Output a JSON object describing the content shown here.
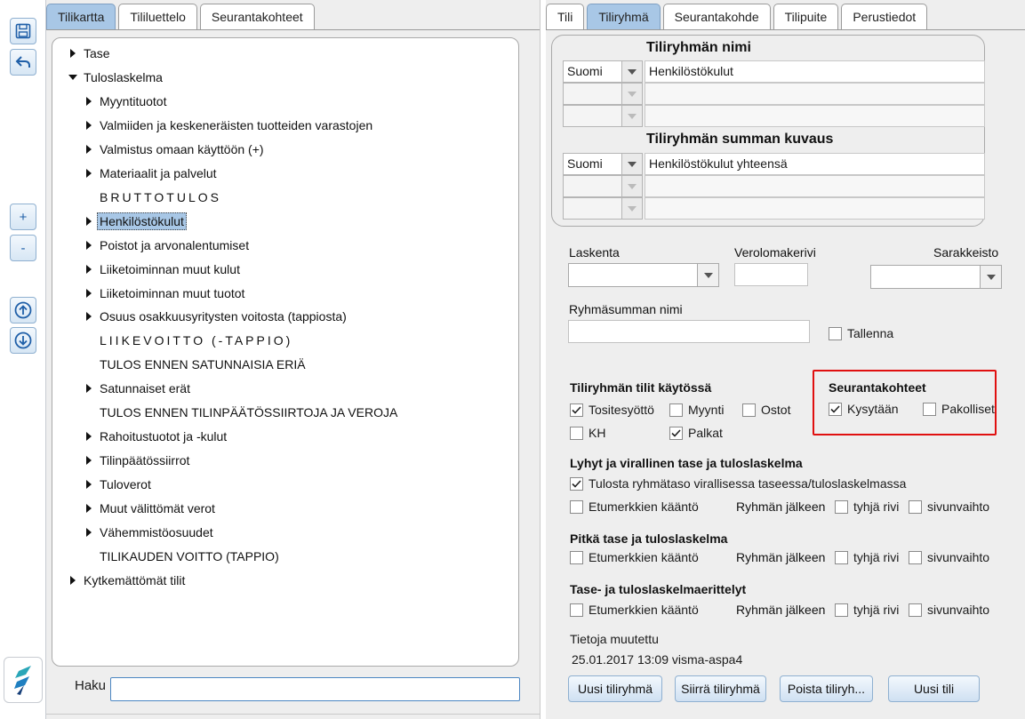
{
  "left_tabs": [
    {
      "label": "Tilikartta",
      "active": true
    },
    {
      "label": "Tililuettelo",
      "active": false
    },
    {
      "label": "Seurantakohteet",
      "active": false
    }
  ],
  "right_tabs": [
    {
      "label": "Tili",
      "active": false
    },
    {
      "label": "Tiliryhmä",
      "active": true
    },
    {
      "label": "Seurantakohde",
      "active": false
    },
    {
      "label": "Tilipuite",
      "active": false
    },
    {
      "label": "Perustiedot",
      "active": false
    }
  ],
  "toolbar": {
    "save_icon": "save-icon",
    "undo_icon": "undo-icon",
    "plus_label": "+",
    "minus_label": "-",
    "up_icon": "arrow-up-circle-icon",
    "down_icon": "arrow-down-circle-icon",
    "logo_icon": "app-logo-icon"
  },
  "tree": [
    {
      "label": "Tase",
      "level": 0,
      "arrow": "right"
    },
    {
      "label": "Tuloslaskelma",
      "level": 0,
      "arrow": "down"
    },
    {
      "label": "Myyntituotot",
      "level": 1,
      "arrow": "right"
    },
    {
      "label": "Valmiiden ja keskeneräisten tuotteiden varastojen",
      "level": 1,
      "arrow": "right"
    },
    {
      "label": "Valmistus omaan käyttöön (+)",
      "level": 1,
      "arrow": "right"
    },
    {
      "label": "Materiaalit ja palvelut",
      "level": 1,
      "arrow": "right"
    },
    {
      "label": "BRUTTOTULOS",
      "level": 1,
      "arrow": "none",
      "spaced": true
    },
    {
      "label": "Henkilöstökulut",
      "level": 1,
      "arrow": "right",
      "selected": true
    },
    {
      "label": "Poistot ja arvonalentumiset",
      "level": 1,
      "arrow": "right"
    },
    {
      "label": "Liiketoiminnan muut kulut",
      "level": 1,
      "arrow": "right"
    },
    {
      "label": "Liiketoiminnan muut tuotot",
      "level": 1,
      "arrow": "right"
    },
    {
      "label": "Osuus osakkuusyritysten voitosta (tappiosta)",
      "level": 1,
      "arrow": "right"
    },
    {
      "label": "LIIKEVOITTO (-TAPPIO)",
      "level": 1,
      "arrow": "none",
      "spaced": true
    },
    {
      "label": "TULOS ENNEN SATUNNAISIA ERIÄ",
      "level": 1,
      "arrow": "none"
    },
    {
      "label": "Satunnaiset erät",
      "level": 1,
      "arrow": "right"
    },
    {
      "label": "TULOS ENNEN TILINPÄÄTÖSSIIRTOJA  JA VEROJA",
      "level": 1,
      "arrow": "none"
    },
    {
      "label": "Rahoitustuotot ja -kulut",
      "level": 1,
      "arrow": "right"
    },
    {
      "label": "Tilinpäätössiirrot",
      "level": 1,
      "arrow": "right"
    },
    {
      "label": "Tuloverot",
      "level": 1,
      "arrow": "right"
    },
    {
      "label": "Muut välittömät verot",
      "level": 1,
      "arrow": "right"
    },
    {
      "label": "Vähemmistöosuudet",
      "level": 1,
      "arrow": "right"
    },
    {
      "label": "TILIKAUDEN VOITTO (TAPPIO)",
      "level": 1,
      "arrow": "none"
    },
    {
      "label": "Kytkemättömät tilit",
      "level": 0,
      "arrow": "right"
    }
  ],
  "search": {
    "label": "Haku",
    "value": ""
  },
  "group": {
    "name_title": "Tiliryhmän nimi",
    "name_rows": [
      {
        "lang": "Suomi",
        "value": "Henkilöstökulut"
      },
      {
        "lang": "",
        "value": ""
      },
      {
        "lang": "",
        "value": ""
      }
    ],
    "sum_title": "Tiliryhmän summan kuvaus",
    "sum_rows": [
      {
        "lang": "Suomi",
        "value": "Henkilöstökulut yhteensä"
      },
      {
        "lang": "",
        "value": ""
      },
      {
        "lang": "",
        "value": ""
      }
    ]
  },
  "fields": {
    "laskenta_label": "Laskenta",
    "laskenta_value": "",
    "verolomakerivi_label": "Verolomakerivi",
    "verolomakerivi_value": "",
    "sarakkeisto_label": "Sarakkeisto",
    "sarakkeisto_value": "",
    "ryhmasumma_label": "Ryhmäsumman nimi",
    "ryhmasumma_value": "",
    "tallenna_label": "Tallenna",
    "tallenna_checked": false
  },
  "accounts_in_use": {
    "title": "Tiliryhmän tilit käytössä",
    "items": [
      {
        "label": "Tositesyöttö",
        "checked": true
      },
      {
        "label": "Myynti",
        "checked": false
      },
      {
        "label": "Ostot",
        "checked": false
      },
      {
        "label": "KH",
        "checked": false
      },
      {
        "label": "Palkat",
        "checked": true
      }
    ]
  },
  "tracking": {
    "title": "Seurantakohteet",
    "items": [
      {
        "label": "Kysytään",
        "checked": true
      },
      {
        "label": "Pakolliset",
        "checked": false
      }
    ]
  },
  "short_report": {
    "title": "Lyhyt ja virallinen tase ja tuloslaskelma",
    "print_label": "Tulosta ryhmätaso virallisessa taseessa/tuloslaskelmassa",
    "print_checked": true,
    "sign_label": "Etumerkkien kääntö",
    "after_label": "Ryhmän jälkeen",
    "empty_row_label": "tyhjä rivi",
    "page_break_label": "sivunvaihto"
  },
  "long_report": {
    "title": "Pitkä tase ja tuloslaskelma",
    "sign_label": "Etumerkkien kääntö",
    "after_label": "Ryhmän jälkeen",
    "empty_row_label": "tyhjä rivi",
    "page_break_label": "sivunvaihto"
  },
  "spec_report": {
    "title": "Tase- ja tuloslaskelmaerittelyt",
    "sign_label": "Etumerkkien kääntö",
    "after_label": "Ryhmän jälkeen",
    "empty_row_label": "tyhjä rivi",
    "page_break_label": "sivunvaihto"
  },
  "info": {
    "modified_label": "Tietoja muutettu",
    "modified_value": "25.01.2017 13:09 visma-aspa4"
  },
  "buttons": {
    "new_group": "Uusi tiliryhmä",
    "move_group": "Siirrä tiliryhmä",
    "delete_group": "Poista tiliryh...",
    "new_account": "Uusi tili"
  },
  "colors": {
    "accent": "#a8c7e6",
    "highlight_box": "#e01010",
    "panel_bg": "#eeeeee"
  }
}
